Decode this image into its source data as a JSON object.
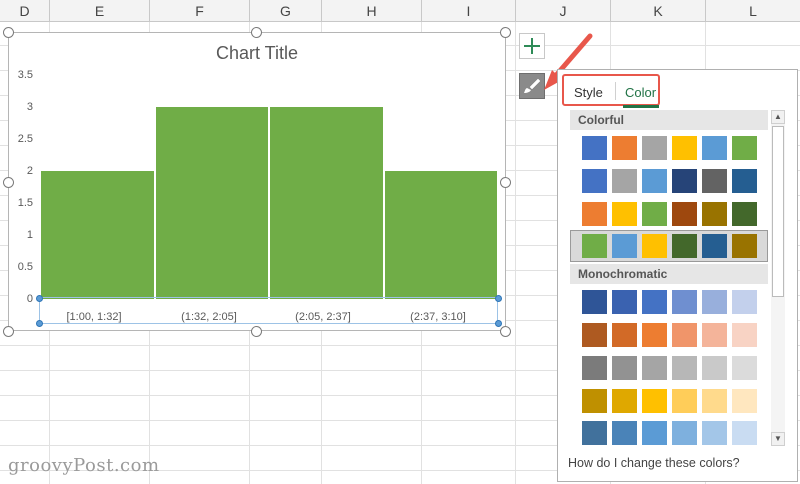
{
  "columns": [
    "D",
    "E",
    "F",
    "G",
    "H",
    "I",
    "J",
    "K",
    "L"
  ],
  "chart": {
    "title": "Chart Title",
    "y_ticks": [
      "3.5",
      "3",
      "2.5",
      "2",
      "1.5",
      "1",
      "0.5",
      "0"
    ]
  },
  "chart_data": {
    "type": "bar",
    "title": "Chart Title",
    "categories": [
      "[1:00, 1:32]",
      "(1:32, 2:05]",
      "(2:05, 2:37]",
      "(2:37, 3:10]"
    ],
    "values": [
      2,
      3,
      3,
      2
    ],
    "ylim": [
      0,
      3.5
    ],
    "grid": false,
    "bar_color": "#70ad47"
  },
  "side_buttons": {
    "elements_icon": "plus-icon",
    "styles_icon": "paintbrush-icon"
  },
  "pane": {
    "tabs": {
      "style": "Style",
      "color": "Color"
    },
    "sections": {
      "colorful": "Colorful",
      "monochromatic": "Monochromatic"
    },
    "help_text": "How do I change these colors?",
    "colorful_rows": [
      [
        "#4472c4",
        "#ed7d31",
        "#a5a5a5",
        "#ffc000",
        "#5b9bd5",
        "#70ad47"
      ],
      [
        "#4472c4",
        "#a5a5a5",
        "#5b9bd5",
        "#264478",
        "#636363",
        "#255e91"
      ],
      [
        "#ed7d31",
        "#ffc000",
        "#70ad47",
        "#9e480e",
        "#997300",
        "#43682b"
      ],
      [
        "#70ad47",
        "#5b9bd5",
        "#ffc000",
        "#43682b",
        "#255e91",
        "#997300"
      ]
    ],
    "monochromatic_rows": [
      [
        "#2f5597",
        "#3a62b0",
        "#4472c4",
        "#6f8fd0",
        "#98afdc",
        "#c3d0ec"
      ],
      [
        "#ae5a21",
        "#d26a27",
        "#ed7d31",
        "#f0956a",
        "#f4b49a",
        "#f8d3c4"
      ],
      [
        "#7b7b7b",
        "#929292",
        "#a5a5a5",
        "#b7b7b7",
        "#c9c9c9",
        "#dbdbdb"
      ],
      [
        "#bf9000",
        "#dfa800",
        "#ffc000",
        "#ffcd59",
        "#ffda8c",
        "#ffe7bf"
      ],
      [
        "#41719c",
        "#4a83b8",
        "#5b9bd5",
        "#7eb0de",
        "#a3c6e8",
        "#c9dcf2"
      ]
    ]
  },
  "watermark": "groovyPost.com",
  "colors": {
    "accent": "#217346",
    "highlight": "#e8574b"
  }
}
